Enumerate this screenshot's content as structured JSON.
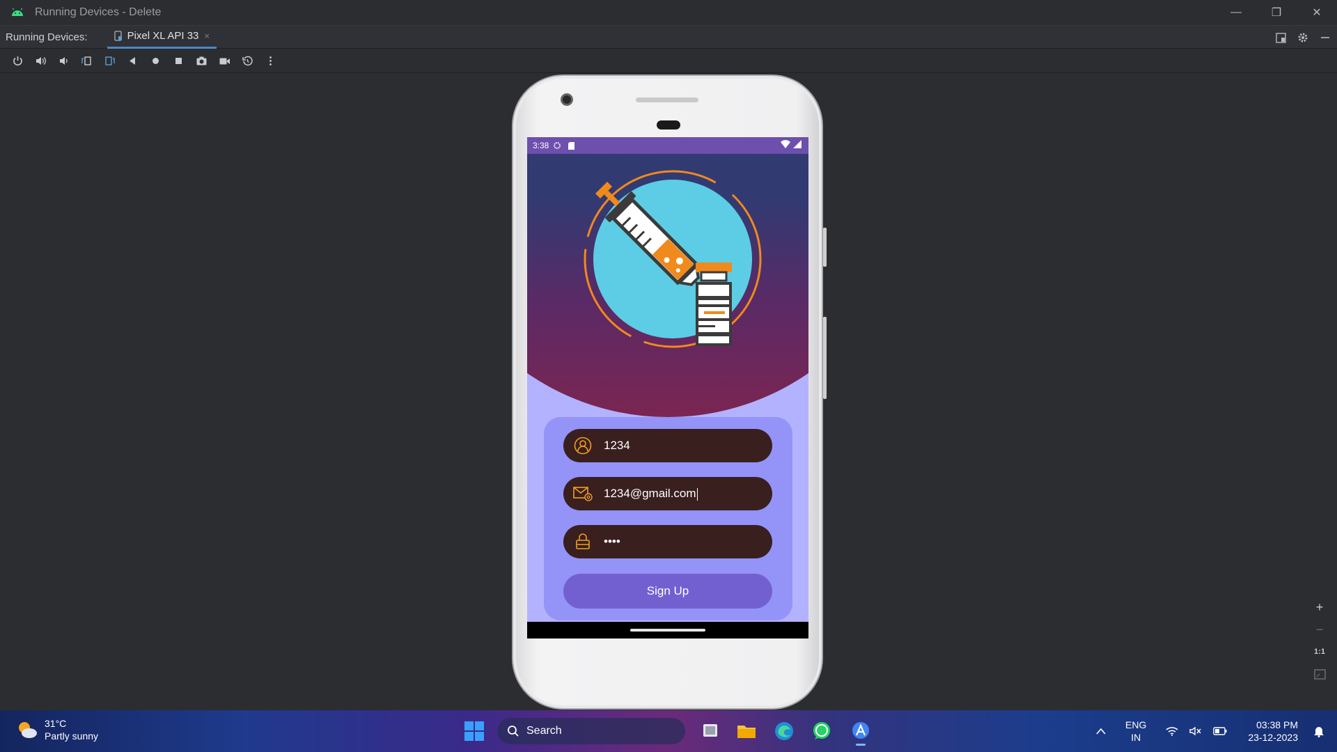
{
  "window": {
    "title": "Running Devices - Delete",
    "controls": [
      "minimize-icon",
      "restore-icon",
      "close-icon"
    ]
  },
  "tabbar": {
    "label": "Running Devices:",
    "tab": {
      "label": "Pixel XL API 33",
      "icon": "device-icon",
      "close": "×"
    },
    "right_icons": [
      "layout-icon",
      "gear-icon",
      "hide-icon"
    ]
  },
  "toolbar": {
    "buttons": [
      "power-icon",
      "volume-up-icon",
      "volume-down-icon",
      "rotate-left-icon",
      "rotate-right-icon",
      "back-icon",
      "home-icon",
      "overview-icon",
      "screenshot-icon",
      "record-icon",
      "reset-icon",
      "more-icon"
    ]
  },
  "device": {
    "status_bar": {
      "time": "3:38"
    },
    "form": {
      "username": "1234",
      "email": "1234@gmail.com",
      "password": "••••",
      "signup_label": "Sign Up"
    },
    "colors": {
      "statusbar": "#6d4fad",
      "field": "#3a1f1f",
      "button": "#7360d0",
      "card": "#9393f8",
      "accent": "#f08a1c"
    }
  },
  "zoom": {
    "zoom_in": "+",
    "zoom_out": "−",
    "actual": "1:1"
  },
  "taskbar": {
    "weather": {
      "temp": "31°C",
      "desc": "Partly sunny"
    },
    "search_label": "Search",
    "language": {
      "line1": "ENG",
      "line2": "IN"
    },
    "clock": {
      "time": "03:38 PM",
      "date": "23-12-2023"
    }
  }
}
